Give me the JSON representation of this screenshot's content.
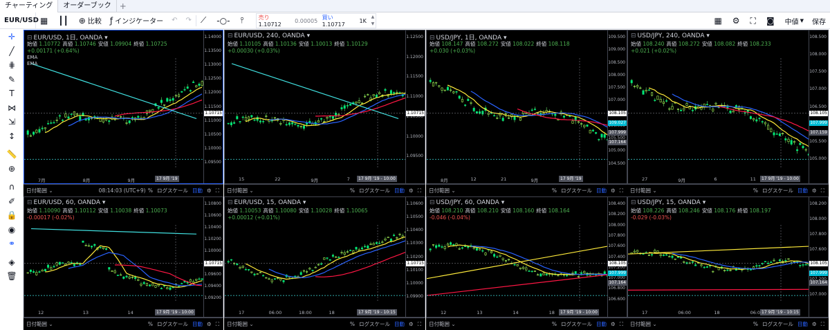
{
  "tabs": [
    "チャーティング",
    "オーダーブック"
  ],
  "toolbar": {
    "symbol": "EUR/USD",
    "compare": "比較",
    "indicators": "インジケーター",
    "sell_label": "売り",
    "sell_price": "1.10712",
    "spread": "0.00005",
    "buy_label": "買い",
    "buy_price": "1.10717",
    "quantity": "1K",
    "layout": "中値",
    "save": "保存"
  },
  "colors": {
    "up": "#4caf50",
    "down": "#00e676",
    "blue": "#2962ff",
    "yellow": "#ffeb3b",
    "red": "#ff1744",
    "cyan": "#40e0e0",
    "accent": "#2962ff"
  },
  "left_icons": [
    "crosshair-icon",
    "trendline-icon",
    "fib-icon",
    "brush-icon",
    "text-icon",
    "pattern-icon",
    "prediction-icon",
    "measure-icon",
    "ruler-icon",
    "zoom-icon",
    "magnet-icon",
    "lock-drawing-icon",
    "lock-icon",
    "eye-icon",
    "link-icon",
    "layers-icon",
    "trash-icon"
  ],
  "bottom": {
    "range": "日付範囲",
    "pct": "%",
    "log": "ログスケール",
    "auto": "目動"
  },
  "panes": [
    {
      "title": "EUR/USD, 1日, OANDA",
      "open": "1.10772",
      "high": "1.10746",
      "low": "1.09904",
      "close": "1.10725",
      "chg": "+0.00171 (+0.64%)",
      "neg": false,
      "extra": [
        "EMA",
        "EMA"
      ],
      "yticks": [
        "1.14000",
        "1.13500",
        "1.13000",
        "1.12500",
        "1.12000",
        "1.11500",
        "1.11000",
        "1.10500",
        "1.10000",
        "1.09500"
      ],
      "xticks": [
        "7月",
        "8月",
        "9月"
      ],
      "date": "17 9月 '19",
      "clock": "08:14:03 (UTC+9)",
      "tag": "1.10715"
    },
    {
      "title": "EUR/USD, 240, OANDA",
      "open": "1.10105",
      "high": "1.10136",
      "low": "1.10013",
      "close": "1.10129",
      "chg": "+0.00030 (+0.03%)",
      "neg": false,
      "extra": [],
      "yticks": [
        "1.12500",
        "1.12000",
        "1.11500",
        "1.11000",
        "1.10500",
        "1.10000",
        "1.09500"
      ],
      "xticks": [
        "15",
        "22",
        "9月",
        "7"
      ],
      "date": "17 9月 '19 - 10:00",
      "clock": "",
      "tag": "1.10715"
    },
    {
      "title": "USD/JPY, 1日, OANDA",
      "open": "108.147",
      "high": "108.272",
      "low": "108.022",
      "close": "108.118",
      "chg": "+0.030 (+0.03%)",
      "neg": false,
      "extra": [],
      "yticks": [
        "109.500",
        "109.000",
        "108.500",
        "108.000",
        "107.500",
        "107.000",
        "106.500",
        "106.000",
        "105.500",
        "105.000",
        "104.500"
      ],
      "xticks": [
        "8月",
        "12",
        "21",
        "9月",
        "11"
      ],
      "date": "17 9月 '19",
      "clock": "",
      "tag": "108.105",
      "tags": [
        "109.027",
        "107.999",
        "107.164"
      ]
    },
    {
      "title": "USD/JPY, 240, OANDA",
      "open": "108.240",
      "high": "108.272",
      "low": "108.082",
      "close": "108.233",
      "chg": "+0.021 (+0.02%)",
      "neg": false,
      "extra": [],
      "yticks": [
        "108.500",
        "108.000",
        "107.500",
        "107.000",
        "106.500",
        "106.000",
        "105.500",
        "105.000"
      ],
      "xticks": [
        "27",
        "9月",
        "6",
        "11"
      ],
      "date": "17 9月 '19 - 10:00",
      "clock": "",
      "tag": "108.105",
      "tags": [
        "107.999",
        "107.159"
      ]
    },
    {
      "title": "EUR/USD, 60, OANDA",
      "open": "1.10090",
      "high": "1.10112",
      "low": "1.10038",
      "close": "1.10073",
      "chg": "-0.00017 (-0.02%)",
      "neg": true,
      "extra": [],
      "yticks": [
        "1.10800",
        "1.10600",
        "1.10400",
        "1.10200",
        "1.10000",
        "1.09800",
        "1.09600",
        "1.09400",
        "1.09200"
      ],
      "xticks": [
        "12",
        "13",
        "14"
      ],
      "date": "17 9月 '19 - 10:00",
      "clock": "",
      "tag": "1.10715"
    },
    {
      "title": "EUR/USD, 15, OANDA",
      "open": "1.10053",
      "high": "1.10080",
      "low": "1.10028",
      "close": "1.10065",
      "chg": "+0.00012 (+0.01%)",
      "neg": false,
      "extra": [],
      "yticks": [
        "1.10600",
        "1.10500",
        "1.10400",
        "1.10300",
        "1.10200",
        "1.10100",
        "1.10000",
        "1.09900"
      ],
      "xticks": [
        "17",
        "06:00",
        "18:00",
        "18",
        "06:00"
      ],
      "date": "17 9月 '19 - 10:15",
      "clock": "",
      "tag": "1.10715"
    },
    {
      "title": "USD/JPY, 60, OANDA",
      "open": "108.210",
      "high": "108.210",
      "low": "108.160",
      "close": "108.164",
      "chg": "-0.046 (-0.04%)",
      "neg": true,
      "extra": [],
      "yticks": [
        "108.400",
        "108.200",
        "108.000",
        "107.800",
        "107.600",
        "107.400",
        "107.200",
        "107.000",
        "106.800",
        "106.600"
      ],
      "xticks": [
        "12",
        "13",
        "14",
        "18"
      ],
      "date": "17 9月 '19 - 10:00",
      "clock": "",
      "tag": "108.105",
      "tags": [
        "107.999",
        "107.164"
      ]
    },
    {
      "title": "USD/JPY, 15, OANDA",
      "open": "108.226",
      "high": "108.246",
      "low": "108.176",
      "close": "108.197",
      "chg": "-0.029 (-0.03%)",
      "neg": true,
      "extra": [],
      "yticks": [
        "108.200",
        "108.000",
        "107.800",
        "107.600",
        "107.400",
        "107.200",
        "107.000"
      ],
      "xticks": [
        "17",
        "06:00",
        "18",
        "06:00"
      ],
      "date": "17 9月 '19 - 10:15",
      "clock": "",
      "tag": "108.105",
      "tags": [
        "107.999",
        "107.164"
      ]
    }
  ]
}
